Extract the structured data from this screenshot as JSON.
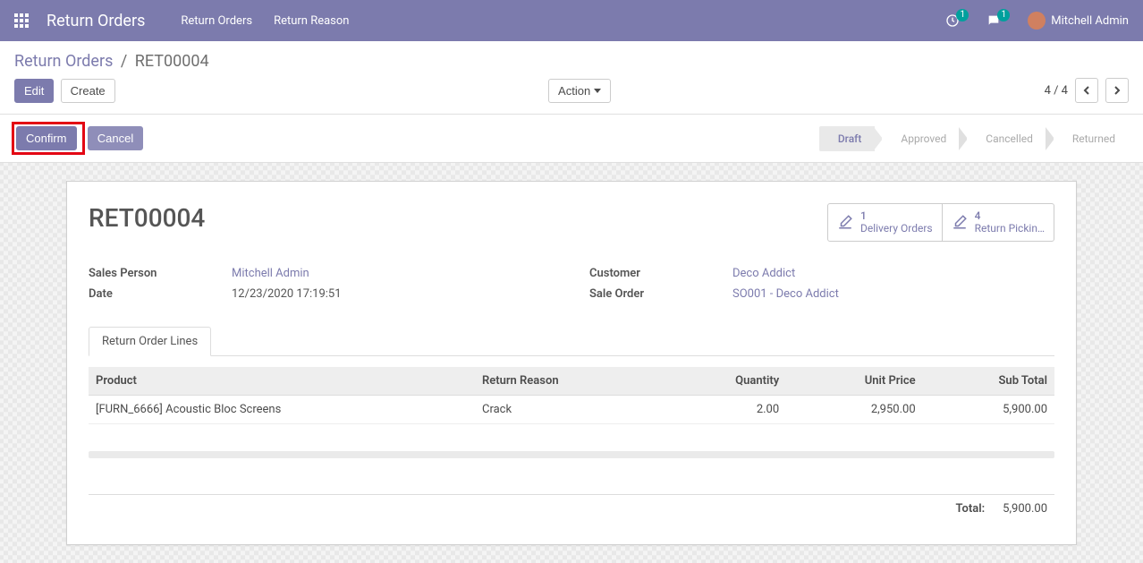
{
  "nav": {
    "brand": "Return Orders",
    "menu": [
      "Return Orders",
      "Return Reason"
    ],
    "activities_badge": "1",
    "messages_badge": "1",
    "user_name": "Mitchell Admin"
  },
  "breadcrumb": {
    "root": "Return Orders",
    "sep": "/",
    "current": "RET00004"
  },
  "buttons": {
    "edit": "Edit",
    "create": "Create",
    "action": "Action",
    "confirm": "Confirm",
    "cancel": "Cancel"
  },
  "pager": {
    "text": "4 / 4"
  },
  "stages": [
    "Draft",
    "Approved",
    "Cancelled",
    "Returned"
  ],
  "record": {
    "name": "RET00004",
    "stat": [
      {
        "count": "1",
        "label": "Delivery Orders"
      },
      {
        "count": "4",
        "label": "Return Pickin…"
      }
    ],
    "fields_left": [
      {
        "k": "Sales Person",
        "v": "Mitchell Admin",
        "link": true
      },
      {
        "k": "Date",
        "v": "12/23/2020 17:19:51",
        "link": false
      }
    ],
    "fields_right": [
      {
        "k": "Customer",
        "v": "Deco Addict",
        "link": true
      },
      {
        "k": "Sale Order",
        "v": "SO001 - Deco Addict",
        "link": true
      }
    ],
    "tab_label": "Return Order Lines",
    "columns": [
      "Product",
      "Return Reason",
      "Quantity",
      "Unit Price",
      "Sub Total"
    ],
    "lines": [
      {
        "product": "[FURN_6666] Acoustic Bloc Screens",
        "reason": "Crack",
        "qty": "2.00",
        "price": "2,950.00",
        "sub": "5,900.00"
      }
    ],
    "total_label": "Total:",
    "total_value": "5,900.00"
  },
  "chart_data": null
}
